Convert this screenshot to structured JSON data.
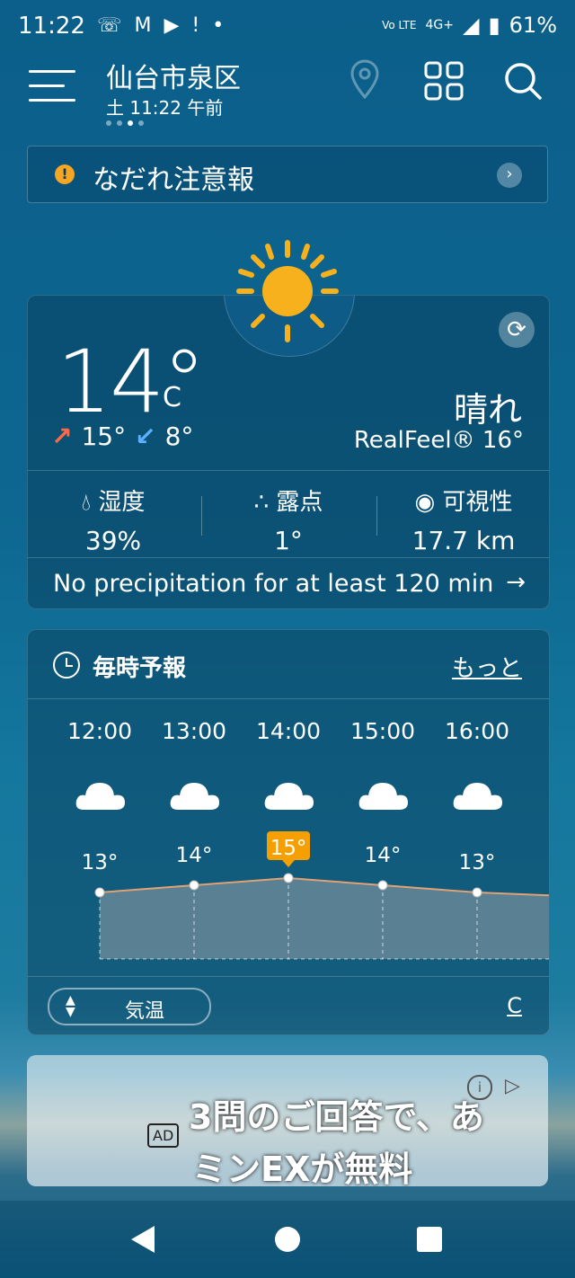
{
  "status_bar": {
    "time": "11:22",
    "icons_left": [
      "missed-call-icon",
      "gmail-icon",
      "play-icon",
      "notification-icon",
      "dot-icon"
    ],
    "network_label": "Vo LTE",
    "network_type": "4G+",
    "battery": "61%"
  },
  "header": {
    "location": "仙台市泉区",
    "datetime": "土 11:22 午前"
  },
  "alert": {
    "text": "なだれ注意報"
  },
  "current": {
    "temperature": "14°",
    "unit": "C",
    "high": "15°",
    "low": "8°",
    "condition": "晴れ",
    "realfeel": "RealFeel® 16°",
    "stats": [
      {
        "label": "湿度",
        "value": "39%",
        "icon": "humidity-icon"
      },
      {
        "label": "露点",
        "value": "1°",
        "icon": "dewpoint-icon"
      },
      {
        "label": "可視性",
        "value": "17.7 km",
        "icon": "visibility-icon"
      }
    ],
    "precip_message": "No precipitation for at least 120 min"
  },
  "hourly": {
    "title": "毎時予報",
    "more": "もっと",
    "toggle_label": "気温",
    "unit_link": "C",
    "chart_data": {
      "type": "line",
      "categories": [
        "12:00",
        "13:00",
        "14:00",
        "15:00",
        "16:00"
      ],
      "series": [
        {
          "values": [
            13,
            14,
            15,
            14,
            13
          ]
        }
      ],
      "labels": [
        "13°",
        "14°",
        "15°",
        "14°",
        "13°"
      ],
      "highlight_index": 2,
      "icons": [
        "cloud-icon",
        "cloud-icon",
        "cloud-icon",
        "cloud-icon",
        "cloud-icon"
      ],
      "colors": {
        "line": "#e0a274",
        "highlight": "#f5a000"
      }
    }
  },
  "ad": {
    "badge": "AD",
    "line1": "3問のご回答で、あ",
    "line2": "ミンEXが無料"
  }
}
